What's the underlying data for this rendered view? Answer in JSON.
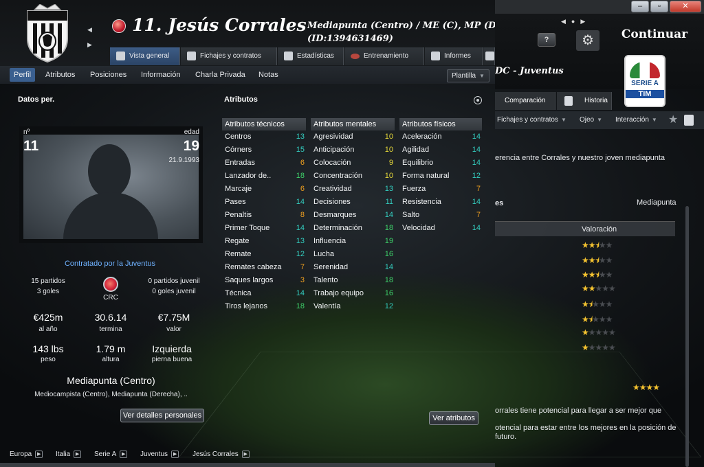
{
  "right_window": {
    "window_buttons": {
      "minimize": "–",
      "maximize": "▫",
      "close": "✕"
    },
    "help_label": "?",
    "continuar_label": "Continuar",
    "league_badge": {
      "line1": "SERIE A",
      "line2": "TIM"
    },
    "club_title": "DC - Juventus",
    "tabs": [
      {
        "label": "Comparación"
      },
      {
        "label": "Historia"
      }
    ],
    "sub_items": [
      {
        "label": "Fichajes y contratos"
      },
      {
        "label": "Ojeo"
      },
      {
        "label": "Interacción"
      }
    ],
    "info_text": "erencia entre Corrales y nuestro joven mediapunta",
    "section_fragment": "es",
    "position_label": "Mediapunta",
    "valoracion_header": "Valoración",
    "ratings": [
      {
        "full": "★★",
        "half": "⯨",
        "empty": "★★"
      },
      {
        "full": "★★",
        "half": "⯨",
        "empty": "★★"
      },
      {
        "full": "★★",
        "half": "⯨",
        "empty": "★★"
      },
      {
        "full": "★★",
        "half": "",
        "empty": "★★★"
      },
      {
        "full": "★",
        "half": "⯨",
        "empty": "★★★"
      },
      {
        "full": "★",
        "half": "⯨",
        "empty": "★★★"
      },
      {
        "full": "★",
        "half": "",
        "empty": "★★★★"
      },
      {
        "full": "★",
        "half": "",
        "empty": "★★★★"
      }
    ],
    "potential_stars": "★★★★",
    "potential_text_1": "orrales tiene potencial para llegar a ser mejor que",
    "potential_text_2": "otencial para estar entre los mejores en la posición de futuro."
  },
  "player": {
    "number_name": "11. Jesús Corrales",
    "positions": "Mediapunta (Centro) / ME (C), MP (D), I",
    "id": "(ID:1394631469)"
  },
  "tabs": [
    {
      "label": "Vista general"
    },
    {
      "label": "Fichajes y contratos"
    },
    {
      "label": "Estadísticas"
    },
    {
      "label": "Entrenamiento"
    },
    {
      "label": "Informes"
    }
  ],
  "subnav": [
    {
      "label": "Perfil"
    },
    {
      "label": "Atributos"
    },
    {
      "label": "Posiciones"
    },
    {
      "label": "Información"
    },
    {
      "label": "Charla Privada"
    },
    {
      "label": "Notas"
    }
  ],
  "plantilla_label": "Plantilla",
  "personal": {
    "title": "Datos per.",
    "number_label": "nº",
    "number": "11",
    "age_label": "edad",
    "age": "19",
    "dob": "21.9.1993",
    "contract_text": "Contratado por la Juventus",
    "matches": "15 partidos",
    "goals": "3 goles",
    "nationality": "CRC",
    "youth_matches": "0 partidos juvenil",
    "youth_goals": "0 goles juvenil",
    "wage": "€425m",
    "wage_label": "al año",
    "contract_end": "30.6.14",
    "contract_end_label": "termina",
    "value": "€7.75M",
    "value_label": "valor",
    "weight": "143 lbs",
    "weight_label": "peso",
    "height": "1.79 m",
    "height_label": "altura",
    "foot": "Izquierda",
    "foot_label": "pierna buena",
    "position_main": "Mediapunta (Centro)",
    "position_sub": "Mediocampista (Centro), Mediapunta (Derecha), ..",
    "details_button": "Ver detalles personales"
  },
  "attributes": {
    "title": "Atributos",
    "tecnicos": {
      "header": "Atributos técnicos",
      "rows": [
        {
          "name": "Centros",
          "value": "13"
        },
        {
          "name": "Córners",
          "value": "15"
        },
        {
          "name": "Entradas",
          "value": "6"
        },
        {
          "name": "Lanzador de..",
          "value": "18"
        },
        {
          "name": "Marcaje",
          "value": "6"
        },
        {
          "name": "Pases",
          "value": "14"
        },
        {
          "name": "Penaltis",
          "value": "8"
        },
        {
          "name": "Primer Toque",
          "value": "14"
        },
        {
          "name": "Regate",
          "value": "13"
        },
        {
          "name": "Remate",
          "value": "12"
        },
        {
          "name": "Remates cabeza",
          "value": "7"
        },
        {
          "name": "Saques largos",
          "value": "3"
        },
        {
          "name": "Técnica",
          "value": "14"
        },
        {
          "name": "Tiros lejanos",
          "value": "18"
        }
      ]
    },
    "mentales": {
      "header": "Atributos mentales",
      "rows": [
        {
          "name": "Agresividad",
          "value": "10"
        },
        {
          "name": "Anticipación",
          "value": "10"
        },
        {
          "name": "Colocación",
          "value": "9"
        },
        {
          "name": "Concentración",
          "value": "10"
        },
        {
          "name": "Creatividad",
          "value": "13"
        },
        {
          "name": "Decisiones",
          "value": "11"
        },
        {
          "name": "Desmarques",
          "value": "14"
        },
        {
          "name": "Determinación",
          "value": "18"
        },
        {
          "name": "Influencia",
          "value": "19"
        },
        {
          "name": "Lucha",
          "value": "16"
        },
        {
          "name": "Serenidad",
          "value": "14"
        },
        {
          "name": "Talento",
          "value": "18"
        },
        {
          "name": "Trabajo equipo",
          "value": "16"
        },
        {
          "name": "Valentía",
          "value": "12"
        }
      ]
    },
    "fisicos": {
      "header": "Atributos físicos",
      "rows": [
        {
          "name": "Aceleración",
          "value": "14"
        },
        {
          "name": "Agilidad",
          "value": "14"
        },
        {
          "name": "Equilibrio",
          "value": "14"
        },
        {
          "name": "Forma natural",
          "value": "12"
        },
        {
          "name": "Fuerza",
          "value": "7"
        },
        {
          "name": "Resistencia",
          "value": "14"
        },
        {
          "name": "Salto",
          "value": "7"
        },
        {
          "name": "Velocidad",
          "value": "14"
        }
      ]
    },
    "button": "Ver atributos"
  },
  "breadcrumb": [
    {
      "label": "Europa"
    },
    {
      "label": "Italia"
    },
    {
      "label": "Serie A"
    },
    {
      "label": "Juventus"
    },
    {
      "label": "Jesús Corrales"
    }
  ],
  "colors": {
    "value_high": "#3ed26a",
    "value_good": "#33cdbf",
    "value_mid": "#e5d83a",
    "value_low": "#f0a020",
    "link": "#6fb2ff",
    "active_tab": "#3a5f8f"
  },
  "icons": {
    "crest": "juventus-crest-icon",
    "nationality": "costa-rica-flag-icon",
    "player_nationality": "player-nationality-ball-icon",
    "gear": "gear-icon",
    "help": "help-icon",
    "star": "star-icon",
    "notes": "notes-icon",
    "radio": "radio-icon"
  }
}
